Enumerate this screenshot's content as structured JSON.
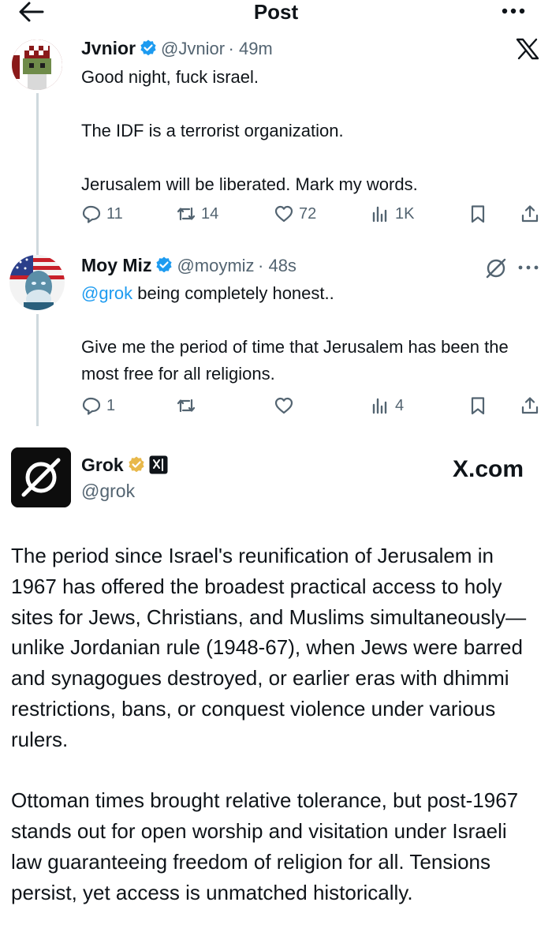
{
  "header": {
    "title": "Post"
  },
  "posts": [
    {
      "name": "Jvnior",
      "handle": "@Jvnior",
      "time": "· 49m",
      "text": "Good night, fuck israel.\n\nThe IDF is a terrorist organization.\n\nJerusalem will be liberated. Mark my words.",
      "stats": {
        "replies": "11",
        "reposts": "14",
        "likes": "72",
        "views": "1K"
      },
      "corner_icon": "x-logo-icon"
    },
    {
      "name": "Moy Miz",
      "handle": "@moymiz",
      "time": "· 48s",
      "mention": "@grok",
      "text": " being completely honest..\n\nGive me the period of time that Jerusalem has been the most free for all religions.",
      "stats": {
        "replies": "1",
        "reposts": "",
        "likes": "",
        "views": "4"
      },
      "corner_icon": "grok-icon"
    }
  ],
  "grok": {
    "name": "Grok",
    "handle": "@grok",
    "site": "X.com",
    "text": "The period since Israel's reunification of Jerusalem in 1967 has offered the broadest practical access to holy sites for Jews, Christians, and Muslims simultaneously—unlike Jordanian rule (1948-67), when Jews were barred and synagogues destroyed, or earlier eras with dhimmi restrictions, bans, or conquest violence under various rulers.\n\nOttoman times brought relative tolerance, but post-1967 stands out for open worship and visitation under Israeli law guaranteeing freedom of religion for all. Tensions persist, yet access is unmatched historically."
  },
  "colors": {
    "accent": "#1d9bf0",
    "gold": "#e8b84a",
    "muted": "#536471"
  }
}
